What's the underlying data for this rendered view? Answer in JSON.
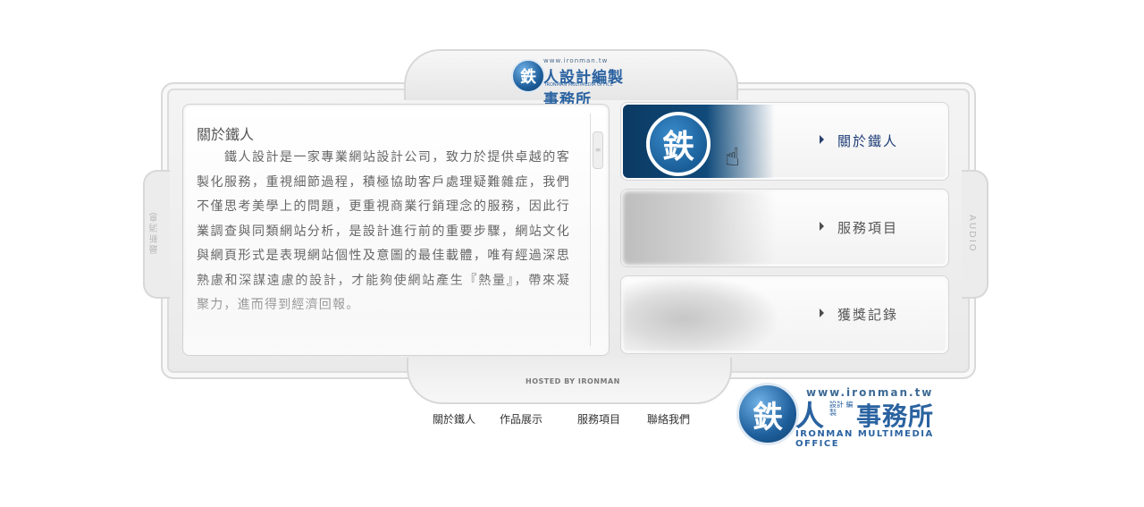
{
  "side": {
    "left_label": "最新消息",
    "right_label": "AUDIO"
  },
  "top_logo": {
    "char": "鉄",
    "url": "www.ironman.tw",
    "name": "人設計編製事務所",
    "subtitle": "IRONMAN MULTIMEDIA OFFICE"
  },
  "content": {
    "title": "關於鐵人",
    "body": "　　鐵人設計是一家專業網站設計公司，致力於提供卓越的客製化服務，重視細節過程，積極協助客戶處理疑難雜症，我們不僅思考美學上的問題，更重視商業行銷理念的服務，因此行業調查與同類網站分析，是設計進行前的重要步驟，網站文化與網頁形式是表現網站個性及意圖的最佳載體，唯有經過深思熟慮和深謀遠慮的設計，才能夠使網站產生『熱量』，帶來凝聚力，進而得到經濟回報。",
    "scroll_grip": "≡"
  },
  "menu": [
    {
      "label": "關於鐵人",
      "thumb_char": "鉄",
      "cursor_icon": "hand-pointer-icon",
      "active": true
    },
    {
      "label": "服務項目",
      "active": false
    },
    {
      "label": "獲獎記錄",
      "active": false
    }
  ],
  "footer": {
    "hosted": "HOSTED BY IRONMAN",
    "links": [
      "關於鐵人",
      "作品展示",
      "服務項目",
      "聯絡我們"
    ]
  },
  "big_logo": {
    "char": "鉄",
    "url": "www.ironman.tw",
    "ren": "人",
    "small": "設計 編製",
    "name": "事務所",
    "subtitle": "IRONMAN MULTIMEDIA OFFICE"
  },
  "colors": {
    "brand_blue": "#2a62a0",
    "dark_navy": "#0b3a63",
    "frame_gray": "#e9e9e9"
  }
}
